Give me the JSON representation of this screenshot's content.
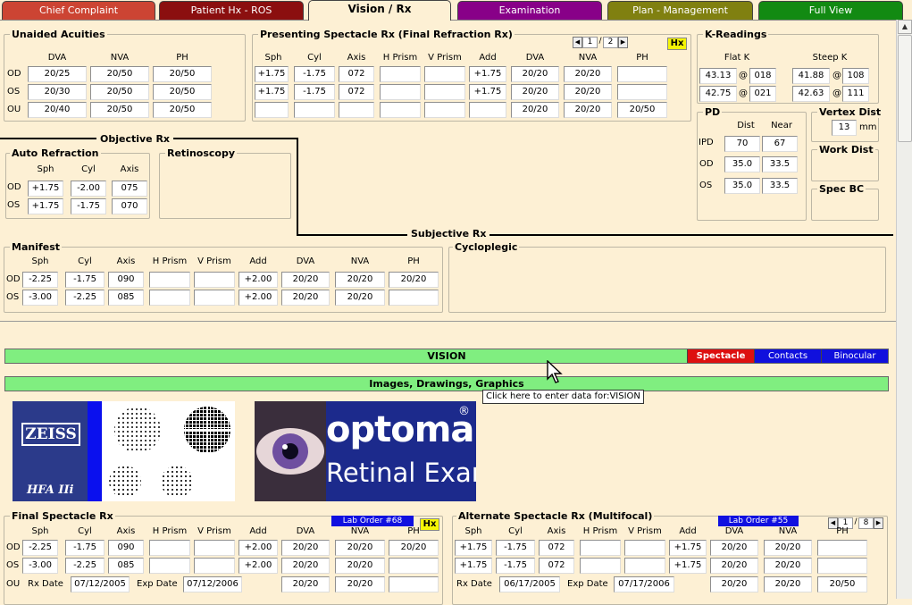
{
  "tabs": [
    "Chief Complaint",
    "Patient Hx - ROS",
    "Vision / Rx",
    "Examination",
    "Plan - Management",
    "Full View"
  ],
  "unaided": {
    "title": "Unaided Acuities",
    "cols": [
      "DVA",
      "NVA",
      "PH"
    ],
    "rows": [
      "OD",
      "OS",
      "OU"
    ],
    "vals": [
      [
        "20/25",
        "20/50",
        "20/50"
      ],
      [
        "20/30",
        "20/50",
        "20/50"
      ],
      [
        "20/40",
        "20/50",
        "20/50"
      ]
    ]
  },
  "presenting": {
    "title": "Presenting Spectacle Rx (Final Refraction Rx)",
    "page": "1",
    "total": "2",
    "hx": "Hx",
    "cols": [
      "Sph",
      "Cyl",
      "Axis",
      "H Prism",
      "V Prism",
      "Add",
      "DVA",
      "NVA",
      "PH"
    ],
    "rows": [
      [
        "+1.75",
        "-1.75",
        "072",
        "",
        "",
        "+1.75",
        "20/20",
        "20/20",
        ""
      ],
      [
        "+1.75",
        "-1.75",
        "072",
        "",
        "",
        "+1.75",
        "20/20",
        "20/20",
        ""
      ],
      [
        "",
        "",
        "",
        "",
        "",
        "",
        "20/20",
        "20/20",
        "20/50"
      ]
    ]
  },
  "kread": {
    "title": "K-Readings",
    "flat": "Flat K",
    "steep": "Steep K",
    "at": "@",
    "vals": [
      [
        "43.13",
        "018",
        "41.88",
        "108"
      ],
      [
        "42.75",
        "021",
        "42.63",
        "111"
      ]
    ]
  },
  "pd": {
    "title": "PD",
    "dist": "Dist",
    "near": "Near",
    "rows": [
      "IPD",
      "OD",
      "OS"
    ],
    "vals": [
      [
        "70",
        "67"
      ],
      [
        "35.0",
        "33.5"
      ],
      [
        "35.0",
        "33.5"
      ]
    ]
  },
  "vertex": {
    "title": "Vertex Dist",
    "value": "13",
    "unit": "mm"
  },
  "work": "Work Dist",
  "specbc": "Spec BC",
  "objective": "Objective Rx",
  "autoref": {
    "title": "Auto Refraction",
    "cols": [
      "Sph",
      "Cyl",
      "Axis"
    ],
    "rows": [
      "OD",
      "OS"
    ],
    "vals": [
      [
        "+1.75",
        "-2.00",
        "075"
      ],
      [
        "+1.75",
        "-1.75",
        "070"
      ]
    ]
  },
  "retino": "Retinoscopy",
  "subjective": "Subjective Rx",
  "manifest": {
    "title": "Manifest",
    "cols": [
      "Sph",
      "Cyl",
      "Axis",
      "H Prism",
      "V Prism",
      "Add",
      "DVA",
      "NVA",
      "PH"
    ],
    "rows": [
      "OD",
      "OS"
    ],
    "vals": [
      [
        "-2.25",
        "-1.75",
        "090",
        "",
        "",
        "+2.00",
        "20/20",
        "20/20",
        "20/20"
      ],
      [
        "-3.00",
        "-2.25",
        "085",
        "",
        "",
        "+2.00",
        "20/20",
        "20/20",
        ""
      ]
    ]
  },
  "cyclo": "Cycloplegic",
  "vision": {
    "label": "VISION",
    "sub": [
      "Spectacle",
      "Contacts",
      "Binocular"
    ]
  },
  "images_label": "Images, Drawings, Graphics",
  "tooltip": "Click here to enter data for:VISION",
  "zeiss": {
    "brand": "ZEISS",
    "model": "HFA IIi"
  },
  "optomap": {
    "brand": "optomap",
    "reg": "®",
    "sub": "Retinal Exam"
  },
  "finalspec": {
    "title": "Final Spectacle Rx",
    "lab": "Lab Order #68",
    "hx": "Hx",
    "cols": [
      "Sph",
      "Cyl",
      "Axis",
      "H Prism",
      "V Prism",
      "Add",
      "DVA",
      "NVA",
      "PH"
    ],
    "rows": [
      "OD",
      "OS",
      "OU"
    ],
    "vals": [
      [
        "-2.25",
        "-1.75",
        "090",
        "",
        "",
        "+2.00",
        "20/20",
        "20/20",
        "20/20"
      ],
      [
        "-3.00",
        "-2.25",
        "085",
        "",
        "",
        "+2.00",
        "20/20",
        "20/20",
        ""
      ]
    ],
    "ou": [
      "20/20",
      "20/20",
      ""
    ],
    "rxdate_lbl": "Rx Date",
    "rxdate": "07/12/2005",
    "expdate_lbl": "Exp Date",
    "expdate": "07/12/2006"
  },
  "altspec": {
    "title": "Alternate Spectacle Rx (Multifocal)",
    "lab": "Lab Order #55",
    "page": "1",
    "total": "8",
    "cols": [
      "Sph",
      "Cyl",
      "Axis",
      "H Prism",
      "V Prism",
      "Add",
      "DVA",
      "NVA",
      "PH"
    ],
    "vals": [
      [
        "+1.75",
        "-1.75",
        "072",
        "",
        "",
        "+1.75",
        "20/20",
        "20/20",
        ""
      ],
      [
        "+1.75",
        "-1.75",
        "072",
        "",
        "",
        "+1.75",
        "20/20",
        "20/20",
        ""
      ]
    ],
    "ou": [
      "20/20",
      "20/20",
      "20/50"
    ],
    "rxdate_lbl": "Rx Date",
    "rxdate": "06/17/2005",
    "expdate_lbl": "Exp Date",
    "expdate": "07/17/2006"
  },
  "colors": {
    "bg": "#fdf0d4",
    "tab1": "#cc4433",
    "tab2": "#8b0f0f",
    "tab4": "#880088",
    "tab5": "#808010",
    "tab6": "#128a12",
    "bar": "#80ee80",
    "spectacle": "#dd1010",
    "contacts": "#1010dd"
  }
}
